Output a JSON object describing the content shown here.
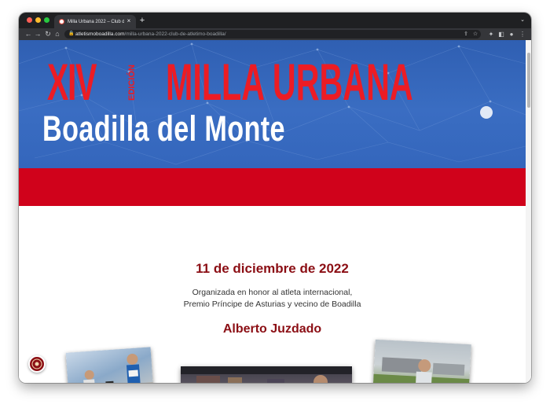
{
  "browser": {
    "tab_title": "Milla Urbana 2022 – Club de a",
    "tab_close": "×",
    "new_tab": "+",
    "tab_menu": "⌄",
    "url_host": "atletismoboadilla.com",
    "url_path": "/milla-urbana-2022-club-de-atletimo-boadilla/",
    "icons": [
      "back-icon",
      "forward-icon",
      "reload-icon",
      "home-icon",
      "lock-icon",
      "share-icon",
      "star-icon",
      "extensions-icon",
      "sidebar-icon",
      "profile-icon",
      "menu-icon"
    ]
  },
  "colors": {
    "brand_red": "#ec1c24",
    "dark_red": "#8b0e14",
    "banner_blue": "#3466bc",
    "band_red": "#d0021b"
  },
  "banner": {
    "edition_roman": "XIV",
    "edition_word": "EDICIÓN",
    "event_name": "MILLA URBANA",
    "town": "Boadilla del Monte"
  },
  "content": {
    "date": "11 de diciembre de 2022",
    "subtitle_line1": "Organizada en honor al atleta internacional,",
    "subtitle_line2": "Premio Príncipe de Asturias y vecino de Boadilla",
    "honoree": "Alberto Juzdado"
  }
}
